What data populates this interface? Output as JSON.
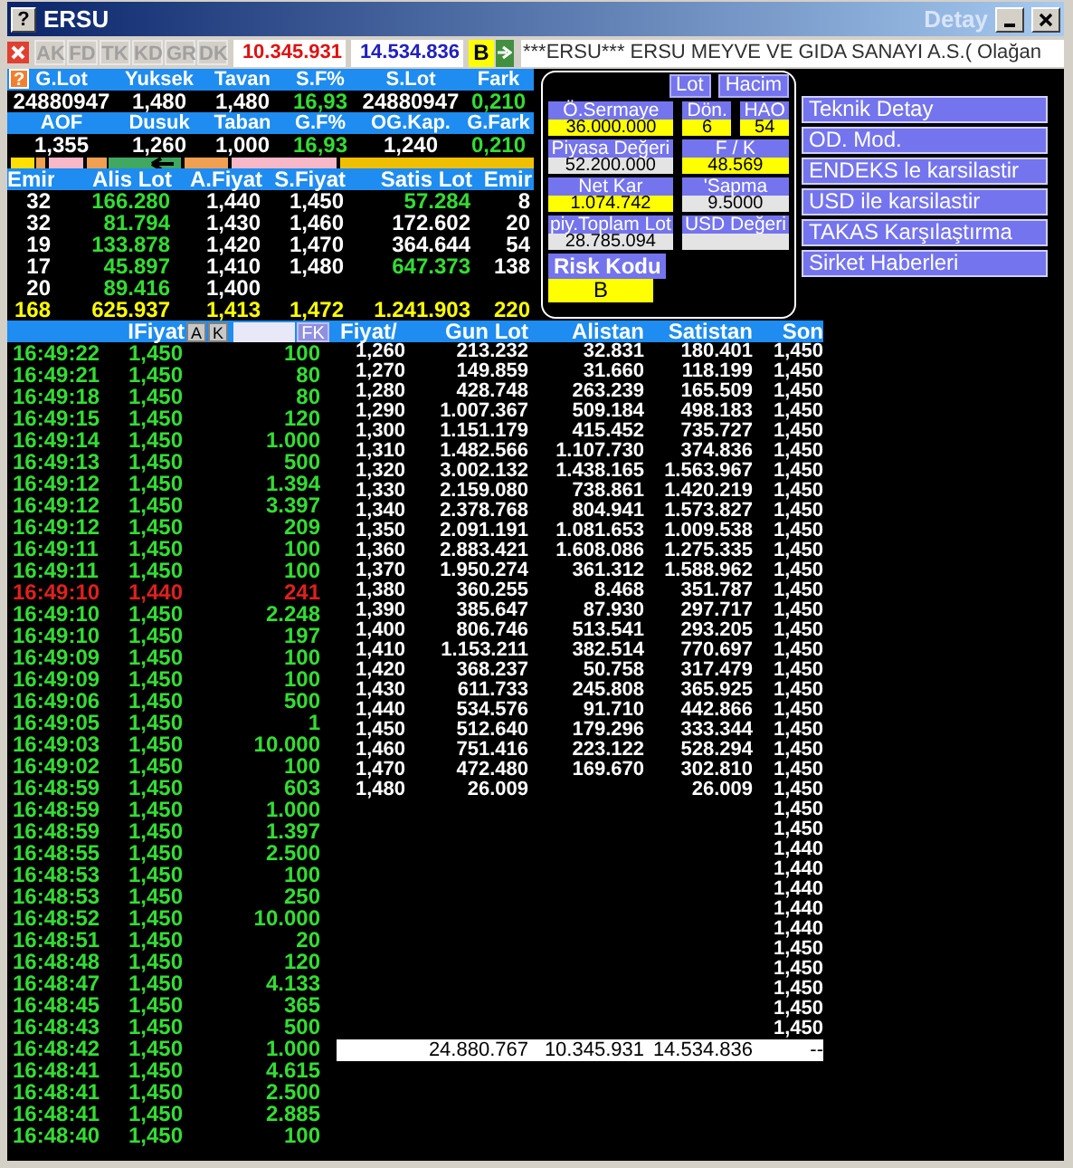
{
  "window": {
    "help": "?",
    "title": "ERSU",
    "subtitle": "Detay"
  },
  "toolbar": {
    "tabs": [
      {
        "label": "AK",
        "disabled": true
      },
      {
        "label": "FD",
        "disabled": true
      },
      {
        "label": "TK",
        "disabled": true
      },
      {
        "label": "KD",
        "disabled": true
      },
      {
        "label": "GR",
        "disabled": true
      },
      {
        "label": "DK",
        "disabled": true
      }
    ],
    "sell_total": "10.345.931",
    "buy_total": "14.534.836",
    "risk": "B",
    "ticker": "***ERSU*** ERSU MEYVE VE GIDA SANAYI A.S.( Olağan"
  },
  "stats": {
    "help": "?",
    "rows": [
      [
        {
          "label": "G.Lot",
          "value": "24880947",
          "up": false
        },
        {
          "label": "Yuksek",
          "value": "1,480",
          "up": false
        },
        {
          "label": "Tavan",
          "value": "1,480",
          "up": false
        },
        {
          "label": "S.F%",
          "value": "16,93",
          "up": true
        },
        {
          "label": "S.Lot",
          "value": "24880947",
          "up": false
        },
        {
          "label": "Fark",
          "value": "0,210",
          "up": true
        }
      ],
      [
        {
          "label": "AOF",
          "value": "1,355",
          "up": false
        },
        {
          "label": "Dusuk",
          "value": "1,260",
          "up": false
        },
        {
          "label": "Taban",
          "value": "1,000",
          "up": false
        },
        {
          "label": "G.F%",
          "value": "16,93",
          "up": true
        },
        {
          "label": "OG.Kap.",
          "value": "1,240",
          "up": false
        },
        {
          "label": "G.Fark",
          "value": "0,210",
          "up": true
        }
      ]
    ]
  },
  "order_book": {
    "columns": [
      "Emir",
      "Alis Lot",
      "A.Fiyat",
      "S.Fiyat",
      "Satis Lot",
      "Emir"
    ],
    "rows": [
      {
        "emir_buy": "32",
        "alis_lot": "166.280",
        "a_fiyat": "1,440",
        "s_fiyat": "1,450",
        "satis_lot": "57.284",
        "satis_up": true,
        "emir_sell": "8"
      },
      {
        "emir_buy": "32",
        "alis_lot": "81.794",
        "a_fiyat": "1,430",
        "s_fiyat": "1,460",
        "satis_lot": "172.602",
        "satis_up": false,
        "emir_sell": "20"
      },
      {
        "emir_buy": "19",
        "alis_lot": "133.878",
        "a_fiyat": "1,420",
        "s_fiyat": "1,470",
        "satis_lot": "364.644",
        "satis_up": false,
        "emir_sell": "54"
      },
      {
        "emir_buy": "17",
        "alis_lot": "45.897",
        "a_fiyat": "1,410",
        "s_fiyat": "1,480",
        "satis_lot": "647.373",
        "satis_up": true,
        "emir_sell": "138"
      },
      {
        "emir_buy": "20",
        "alis_lot": "89.416",
        "a_fiyat": "1,400"
      }
    ],
    "totals": [
      "168",
      "625.937",
      "1,413",
      "1,472",
      "1.241.903",
      "220"
    ]
  },
  "info_box": {
    "buttons": [
      "Lot",
      "Hacim"
    ],
    "rows": [
      [
        {
          "label": "Ö.Sermaye",
          "value": "36.000.000",
          "color": "#ffff00"
        },
        {
          "label": "Dön.",
          "value": "6",
          "color": "#ffff00"
        },
        {
          "label": "HAO",
          "value": "54",
          "color": "#ffff00"
        }
      ],
      [
        {
          "label": "Piyasa Değeri",
          "value": "52.200.000",
          "color": "#e4e4e4"
        },
        {
          "label": "F / K",
          "value": "48.569",
          "color": "#ffff00"
        }
      ],
      [
        {
          "label": "Net Kar",
          "value": "1.074.742",
          "color": "#ffff00"
        },
        {
          "label": "'Sapma",
          "value": "9.5000",
          "color": "#e4e4e4"
        }
      ],
      [
        {
          "label": "piy.Toplam Lot",
          "value": "28.785.094",
          "color": "#e4e4e4"
        },
        {
          "label": "USD Değeri",
          "color": "#e4e4e4"
        }
      ]
    ],
    "risk": {
      "label": "Risk Kodu",
      "value": "B"
    }
  },
  "menu": [
    "Teknik Detay",
    "OD. Mod.",
    "ENDEKS le karsilastir",
    "USD ile karsilastir",
    "TAKAS Karşılaştırma",
    "Sirket Haberleri"
  ],
  "trades": {
    "price_label": "IFiyat",
    "buttons": [
      "A",
      "K"
    ],
    "filter": "FK",
    "rows": [
      {
        "time": "16:49:22",
        "price": "1,450",
        "lot": "100",
        "down": false
      },
      {
        "time": "16:49:21",
        "price": "1,450",
        "lot": "80",
        "down": false
      },
      {
        "time": "16:49:18",
        "price": "1,450",
        "lot": "80",
        "down": false
      },
      {
        "time": "16:49:15",
        "price": "1,450",
        "lot": "120",
        "down": false
      },
      {
        "time": "16:49:14",
        "price": "1,450",
        "lot": "1.000",
        "down": false
      },
      {
        "time": "16:49:13",
        "price": "1,450",
        "lot": "500",
        "down": false
      },
      {
        "time": "16:49:12",
        "price": "1,450",
        "lot": "1.394",
        "down": false
      },
      {
        "time": "16:49:12",
        "price": "1,450",
        "lot": "3.397",
        "down": false
      },
      {
        "time": "16:49:12",
        "price": "1,450",
        "lot": "209",
        "down": false
      },
      {
        "time": "16:49:11",
        "price": "1,450",
        "lot": "100",
        "down": false
      },
      {
        "time": "16:49:11",
        "price": "1,450",
        "lot": "100",
        "down": false
      },
      {
        "time": "16:49:10",
        "price": "1,440",
        "lot": "241",
        "down": true
      },
      {
        "time": "16:49:10",
        "price": "1,450",
        "lot": "2.248",
        "down": false
      },
      {
        "time": "16:49:10",
        "price": "1,450",
        "lot": "197",
        "down": false
      },
      {
        "time": "16:49:09",
        "price": "1,450",
        "lot": "100",
        "down": false
      },
      {
        "time": "16:49:09",
        "price": "1,450",
        "lot": "100",
        "down": false
      },
      {
        "time": "16:49:06",
        "price": "1,450",
        "lot": "500",
        "down": false
      },
      {
        "time": "16:49:05",
        "price": "1,450",
        "lot": "1",
        "down": false
      },
      {
        "time": "16:49:03",
        "price": "1,450",
        "lot": "10.000",
        "down": false
      },
      {
        "time": "16:49:02",
        "price": "1,450",
        "lot": "100",
        "down": false
      },
      {
        "time": "16:48:59",
        "price": "1,450",
        "lot": "603",
        "down": false
      },
      {
        "time": "16:48:59",
        "price": "1,450",
        "lot": "1.000",
        "down": false
      },
      {
        "time": "16:48:59",
        "price": "1,450",
        "lot": "1.397",
        "down": false
      },
      {
        "time": "16:48:55",
        "price": "1,450",
        "lot": "2.500",
        "down": false
      },
      {
        "time": "16:48:53",
        "price": "1,450",
        "lot": "100",
        "down": false
      },
      {
        "time": "16:48:53",
        "price": "1,450",
        "lot": "250",
        "down": false
      },
      {
        "time": "16:48:52",
        "price": "1,450",
        "lot": "10.000",
        "down": false
      },
      {
        "time": "16:48:51",
        "price": "1,450",
        "lot": "20",
        "down": false
      },
      {
        "time": "16:48:48",
        "price": "1,450",
        "lot": "120",
        "down": false
      },
      {
        "time": "16:48:47",
        "price": "1,450",
        "lot": "4.133",
        "down": false
      },
      {
        "time": "16:48:45",
        "price": "1,450",
        "lot": "365",
        "down": false
      },
      {
        "time": "16:48:43",
        "price": "1,450",
        "lot": "500",
        "down": false
      },
      {
        "time": "16:48:42",
        "price": "1,450",
        "lot": "1.000",
        "down": false
      },
      {
        "time": "16:48:41",
        "price": "1,450",
        "lot": "4.615",
        "down": false
      },
      {
        "time": "16:48:41",
        "price": "1,450",
        "lot": "2.500",
        "down": false
      },
      {
        "time": "16:48:41",
        "price": "1,450",
        "lot": "2.885",
        "down": false
      },
      {
        "time": "16:48:40",
        "price": "1,450",
        "lot": "100",
        "down": false
      }
    ]
  },
  "price_table": {
    "columns": [
      "Fiyat/",
      "Gun Lot",
      "Alistan",
      "Satistan",
      "Son"
    ],
    "rows": [
      {
        "fiyat": "1,260",
        "gun_lot": "213.232",
        "alistan": "32.831",
        "satistan": "180.401"
      },
      {
        "fiyat": "1,270",
        "gun_lot": "149.859",
        "alistan": "31.660",
        "satistan": "118.199"
      },
      {
        "fiyat": "1,280",
        "gun_lot": "428.748",
        "alistan": "263.239",
        "satistan": "165.509"
      },
      {
        "fiyat": "1,290",
        "gun_lot": "1.007.367",
        "alistan": "509.184",
        "satistan": "498.183"
      },
      {
        "fiyat": "1,300",
        "gun_lot": "1.151.179",
        "alistan": "415.452",
        "satistan": "735.727"
      },
      {
        "fiyat": "1,310",
        "gun_lot": "1.482.566",
        "alistan": "1.107.730",
        "satistan": "374.836"
      },
      {
        "fiyat": "1,320",
        "gun_lot": "3.002.132",
        "alistan": "1.438.165",
        "satistan": "1.563.967"
      },
      {
        "fiyat": "1,330",
        "gun_lot": "2.159.080",
        "alistan": "738.861",
        "satistan": "1.420.219"
      },
      {
        "fiyat": "1,340",
        "gun_lot": "2.378.768",
        "alistan": "804.941",
        "satistan": "1.573.827"
      },
      {
        "fiyat": "1,350",
        "gun_lot": "2.091.191",
        "alistan": "1.081.653",
        "satistan": "1.009.538"
      },
      {
        "fiyat": "1,360",
        "gun_lot": "2.883.421",
        "alistan": "1.608.086",
        "satistan": "1.275.335"
      },
      {
        "fiyat": "1,370",
        "gun_lot": "1.950.274",
        "alistan": "361.312",
        "satistan": "1.588.962"
      },
      {
        "fiyat": "1,380",
        "gun_lot": "360.255",
        "alistan": "8.468",
        "satistan": "351.787"
      },
      {
        "fiyat": "1,390",
        "gun_lot": "385.647",
        "alistan": "87.930",
        "satistan": "297.717"
      },
      {
        "fiyat": "1,400",
        "gun_lot": "806.746",
        "alistan": "513.541",
        "satistan": "293.205"
      },
      {
        "fiyat": "1,410",
        "gun_lot": "1.153.211",
        "alistan": "382.514",
        "satistan": "770.697"
      },
      {
        "fiyat": "1,420",
        "gun_lot": "368.237",
        "alistan": "50.758",
        "satistan": "317.479"
      },
      {
        "fiyat": "1,430",
        "gun_lot": "611.733",
        "alistan": "245.808",
        "satistan": "365.925"
      },
      {
        "fiyat": "1,440",
        "gun_lot": "534.576",
        "alistan": "91.710",
        "satistan": "442.866"
      },
      {
        "fiyat": "1,450",
        "gun_lot": "512.640",
        "alistan": "179.296",
        "satistan": "333.344"
      },
      {
        "fiyat": "1,460",
        "gun_lot": "751.416",
        "alistan": "223.122",
        "satistan": "528.294"
      },
      {
        "fiyat": "1,470",
        "gun_lot": "472.480",
        "alistan": "169.670",
        "satistan": "302.810"
      },
      {
        "fiyat": "1,480",
        "gun_lot": "26.009",
        "satistan": "26.009"
      }
    ],
    "son": [
      "1,450",
      "1,450",
      "1,450",
      "1,450",
      "1,450",
      "1,450",
      "1,450",
      "1,450",
      "1,450",
      "1,450",
      "1,450",
      "1,450",
      "1,450",
      "1,450",
      "1,450",
      "1,450",
      "1,450",
      "1,450",
      "1,450",
      "1,450",
      "1,450",
      "1,450",
      "1,450",
      "1,450",
      "1,450",
      "1,440",
      "1,440",
      "1,440",
      "1,440",
      "1,440",
      "1,450",
      "1,450",
      "1,450",
      "1,450",
      "1,450"
    ],
    "totals": {
      "gun_lot": "24.880.767",
      "alistan": "10.345.931",
      "satistan": "14.534.836",
      "son": "--"
    }
  }
}
